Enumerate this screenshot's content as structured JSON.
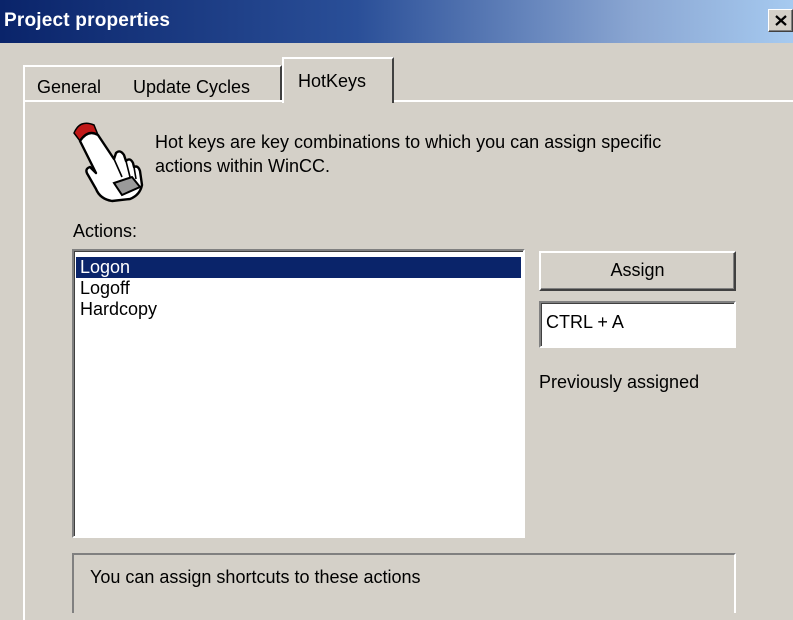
{
  "window": {
    "title": "Project properties",
    "close_icon": "close-icon"
  },
  "tabs": [
    {
      "label": "General",
      "active": false
    },
    {
      "label": "Update Cycles",
      "active": false
    },
    {
      "label": "HotKeys",
      "active": true
    }
  ],
  "hotkeys": {
    "icon": "hand-pointer-icon",
    "description": "Hot keys are key combinations to which you can assign specific actions within WinCC.",
    "actions_label": "Actions:",
    "actions": [
      {
        "label": "Logon",
        "selected": true
      },
      {
        "label": "Logoff",
        "selected": false
      },
      {
        "label": "Hardcopy",
        "selected": false
      }
    ],
    "assign_label": "Assign",
    "hotkey_value": "CTRL + A",
    "previously_assigned_label": "Previously assigned",
    "status_text": "You can assign shortcuts to these actions"
  },
  "colors": {
    "face": "#d4d0c8",
    "selection": "#0a246a",
    "title_gradient_start": "#0a246a",
    "title_gradient_end": "#a6caf0"
  }
}
